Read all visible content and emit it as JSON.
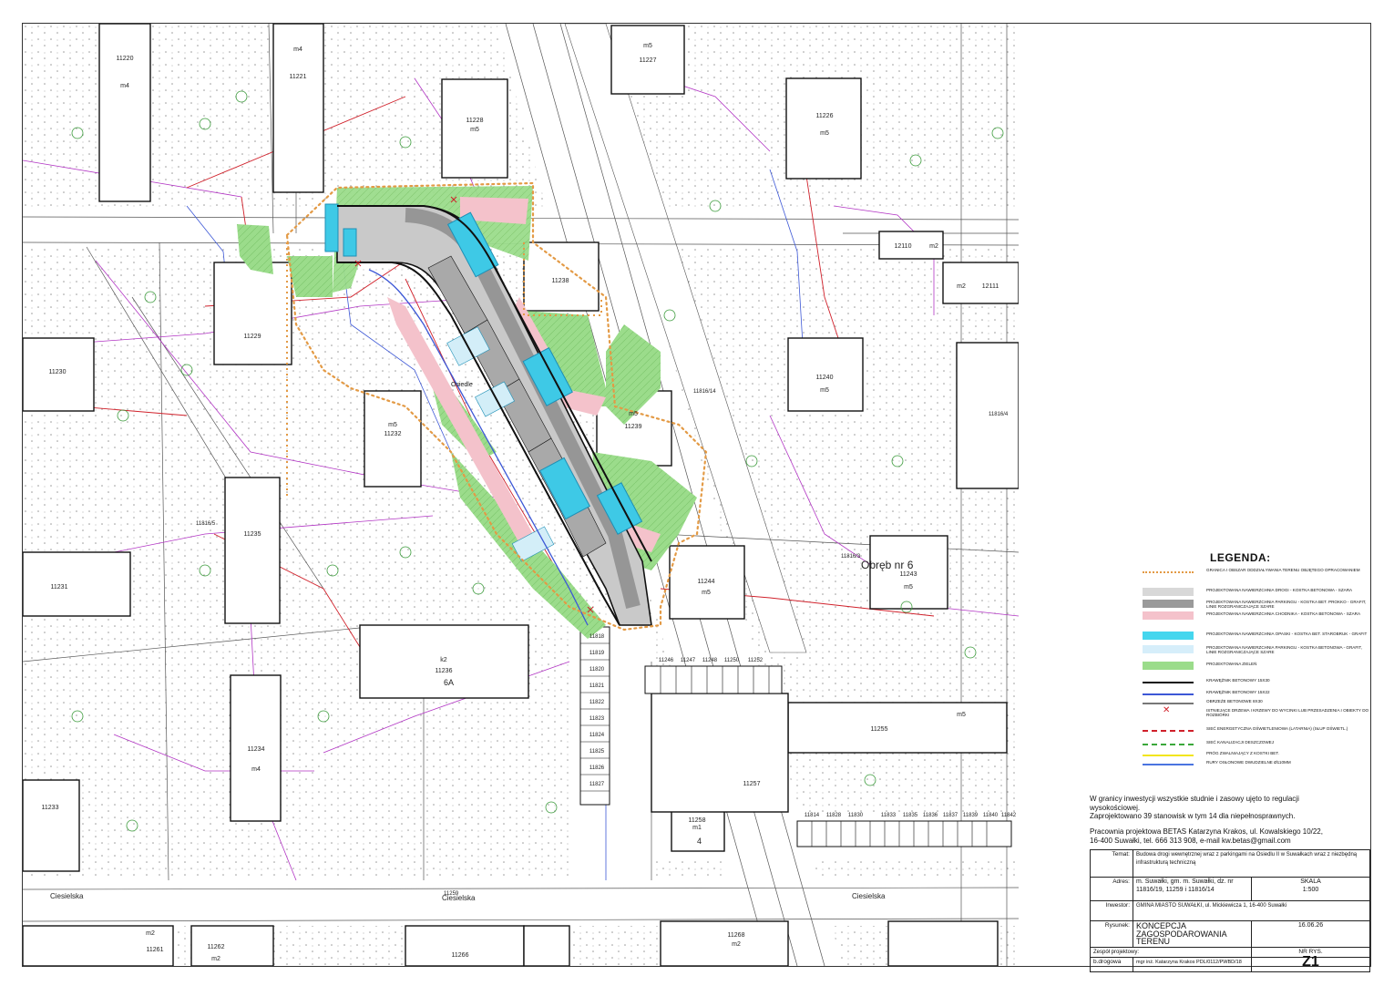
{
  "map": {
    "parcels": [
      {
        "id": "11220",
        "cls": "m4"
      },
      {
        "id": "11221",
        "cls": "m4"
      },
      {
        "id": "11227",
        "cls": "m5"
      },
      {
        "id": "11228",
        "cls": "m5"
      },
      {
        "id": "11226",
        "cls": "m5"
      },
      {
        "id": "11229",
        "cls": ""
      },
      {
        "id": "11230",
        "cls": ""
      },
      {
        "id": "11232",
        "cls": "m5"
      },
      {
        "id": "11238",
        "cls": ""
      },
      {
        "id": "11239",
        "cls": "m5"
      },
      {
        "id": "11240",
        "cls": "m5"
      },
      {
        "id": "11235",
        "cls": ""
      },
      {
        "id": "11231",
        "cls": ""
      },
      {
        "id": "11236",
        "cls": "k2"
      },
      {
        "id": "11234",
        "cls": "m4"
      },
      {
        "id": "11244",
        "cls": "m5"
      },
      {
        "id": "11243",
        "cls": "m5"
      },
      {
        "id": "11255",
        "cls": "m5"
      },
      {
        "id": "11257",
        "cls": ""
      },
      {
        "id": "11258",
        "cls": "m1"
      },
      {
        "id": "11233",
        "cls": ""
      },
      {
        "id": "11261",
        "cls": "m2"
      },
      {
        "id": "11262",
        "cls": "m2"
      },
      {
        "id": "11266",
        "cls": ""
      },
      {
        "id": "11268",
        "cls": "m2"
      },
      {
        "id": "12110",
        "cls": "m2"
      },
      {
        "id": "12111",
        "cls": "m2"
      }
    ],
    "labels": {
      "obreb": "Obręb nr 6",
      "street": "Ciesielska",
      "osiedle": "Osiedle",
      "parcel_11816_5": "11816/5",
      "parcel_11816_3": "11816/3",
      "parcel_11816_4": "11816/4",
      "parcel_11816_14": "11816/14",
      "parcel_11259": "11259",
      "house_6a": "6A",
      "house_4": "4"
    },
    "garage_ids": [
      "11818",
      "11819",
      "11820",
      "11821",
      "11822",
      "11823",
      "11824",
      "11825",
      "11826",
      "11827"
    ],
    "garage_row_top": [
      "11246",
      "11247",
      "11248",
      "11250",
      "11252"
    ],
    "garage_row_bottom": [
      "11814",
      "11828",
      "11830",
      "11833",
      "11835",
      "11836",
      "11837",
      "11839",
      "11840",
      "11842"
    ],
    "colors": {
      "road": "#a9a9a9",
      "parking": "#c9c9c9",
      "pavement": "#f4c2cb",
      "parking_cyan": "#3ec9e6",
      "parking_light": "#d3eef8",
      "green": "#9bdc8b",
      "boundary": "#e39a45",
      "red_line": "#d0202a",
      "magenta": "#b235c4",
      "blue": "#3c57d6"
    }
  },
  "legend": {
    "title": "LEGENDA:",
    "items": [
      {
        "label": "GRANICA I OBSZAR ODDZIAŁYWANIA TERENU OBJĘTEGO OPRACOWANIEM",
        "kind": "dots",
        "color": "#e39a45"
      },
      {
        "label": "PROJEKTOWANA NAWIERZCHNIA DROGI - KOSTKA BETONOWA - SZARA",
        "kind": "fill",
        "color": "#d8d8d8"
      },
      {
        "label": "PROJEKTOWANA NAWIERZCHNIA PARKINGU - KOSTKA BET. PROKKO - GRAFIT, LINIE ROZGRANICZAJĄCE SZARE",
        "kind": "fill",
        "color": "#9a9a9a"
      },
      {
        "label": "PROJEKTOWANA NAWIERZCHNIA CHODNIKA - KOSTKA BETONOWA - SZARA",
        "kind": "fill",
        "color": "#f4c2cb"
      },
      {
        "label": "PROJEKTOWANA NAWIERZCHNIA OPASKI - KOSTKA BET. STAROBRUK - GRAFIT",
        "kind": "fill",
        "color": "#45d6ee"
      },
      {
        "label": "PROJEKTOWANA NAWIERZCHNIA PARKINGU - KOSTKA BETONOWA - GRAFIT, LINIE ROZGRANICZAJĄCE SZARE",
        "kind": "fill",
        "color": "#d6eefa"
      },
      {
        "label": "PROJEKTOWANA ZIELEŃ",
        "kind": "fill",
        "color": "#9bdc8b"
      },
      {
        "label": "KRAWĘŻNIK BETONOWY 15X30",
        "kind": "line",
        "color": "#111111"
      },
      {
        "label": "KRAWĘŻNIK BETONOWY 15X22",
        "kind": "line",
        "color": "#3c57d6"
      },
      {
        "label": "OBRZEŻE BETONOWE 8X30",
        "kind": "line",
        "color": "#777777"
      },
      {
        "label": "ISTNIEJĄCE DRZEWA I KRZEWY DO WYCINKI LUB PRZESADZENIA I OBIEKTY DO ROZBIÓRKI",
        "kind": "cross",
        "color": "#d0202a"
      },
      {
        "label": "SIEĆ ENERGETYCZNA OŚWIETLENIOWA (latarnia) (słup oświetl.)",
        "kind": "dashed",
        "color": "#d0202a"
      },
      {
        "label": "SIEĆ KANALIZACJI DESZCZOWEJ",
        "kind": "dashed",
        "color": "#3aa83a"
      },
      {
        "label": "PRÓG ZWALNIAJĄCY Z KOSTKI BET.",
        "kind": "line",
        "color": "#f2e51c"
      },
      {
        "label": "RURY OSŁONOWE DWUDZIELNE Ø110mm",
        "kind": "line",
        "color": "#4a74e0"
      }
    ]
  },
  "notes": {
    "line1": "W granicy inwestycji wszystkie studnie i zasowy ujęto to regulacji",
    "line2": "wysokościowej.",
    "line3": "Zaprojektowano 39 stanowisk w tym 14 dla niepełnosprawnych."
  },
  "titleblock": {
    "office_line1": "Pracownia projektowa BETAS Katarzyna Krakos, ul. Kowalskiego 10/22,",
    "office_line2": "16-400 Suwałki, tel. 666 313 908, e-mail kw.betas@gmail.com",
    "temat_key": "Temat:",
    "temat_val": "Budowa drogi wewnętrznej wraz z parkingami na Osiedlu II w Suwałkach wraz z niezbędną infrastrukturą techniczną",
    "adres_key": "Adres:",
    "adres_val": "m. Suwałki, gm. m. Suwałki, dz. nr 11816/19, 11259 i 11816/14",
    "skala_key": "SKALA",
    "skala_val": "1:500",
    "inwestor_key": "Inwestor:",
    "inwestor_val": "GMINA MIASTO SUWAŁKI, ul. Mickiewicza 1, 16-400 Suwałki",
    "rysunek_key": "Rysunek:",
    "rysunek_val": "KONCEPCJA ZAGOSPODAROWANIA TERENU",
    "date": "16.06.26",
    "zespol": "Zespół projektowy:",
    "nrrys_key": "NR RYS.",
    "branza": "b.drogowa",
    "author": "mgr inż. Katarzyna Krakos PDL/0112/PWBD/18",
    "nrrys_val": "Z1"
  }
}
